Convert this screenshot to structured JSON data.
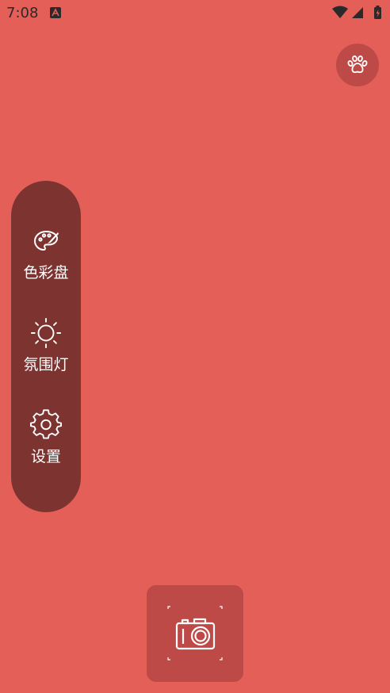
{
  "status_bar": {
    "time": "7:08",
    "icons": [
      "app-notification-icon",
      "wifi-icon",
      "cell-signal-icon",
      "battery-charging-icon"
    ]
  },
  "top_right": {
    "icon": "paw-icon"
  },
  "side_menu": {
    "items": [
      {
        "icon": "palette-icon",
        "label": "色彩盘"
      },
      {
        "icon": "sun-icon",
        "label": "氛围灯"
      },
      {
        "icon": "gear-icon",
        "label": "设置"
      }
    ]
  },
  "bottom": {
    "icon": "camera-icon"
  },
  "colors": {
    "background": "#E35F58",
    "panel": "#7D3431",
    "button": "#BD4A47",
    "status_text": "#2a2a2a"
  }
}
